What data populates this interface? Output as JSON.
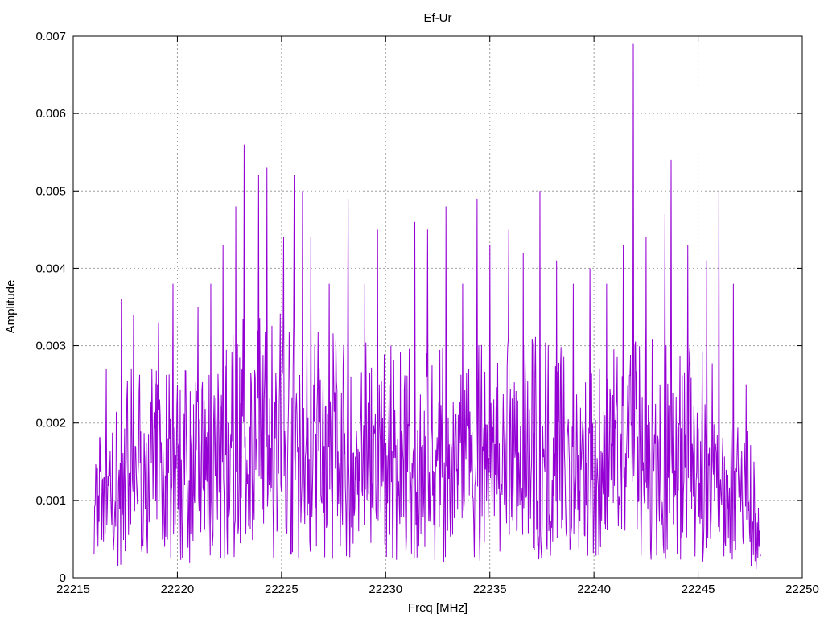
{
  "chart_data": {
    "type": "line",
    "title": "Ef-Ur",
    "xlabel": "Freq [MHz]",
    "ylabel": "Amplitude",
    "xlim": [
      22215,
      22250
    ],
    "ylim": [
      0,
      0.007
    ],
    "xticks": [
      22215,
      22220,
      22225,
      22230,
      22235,
      22240,
      22245,
      22250
    ],
    "yticks": [
      0,
      0.001,
      0.002,
      0.003,
      0.004,
      0.005,
      0.006,
      0.007
    ],
    "ytick_labels": [
      "0",
      "0.001",
      "0.002",
      "0.003",
      "0.004",
      "0.005",
      "0.006",
      "0.007"
    ],
    "grid": true,
    "legend": "none",
    "series": [
      {
        "color": "#9400d3",
        "x_start": 22216.0,
        "x_end": 22248.0,
        "points": 1200,
        "seed": 7,
        "envelope": [
          [
            22216.0,
            0.0012
          ],
          [
            22218.0,
            0.0019
          ],
          [
            22220.0,
            0.0018
          ],
          [
            22222.0,
            0.002
          ],
          [
            22224.0,
            0.0024
          ],
          [
            22226.0,
            0.0024
          ],
          [
            22228.0,
            0.0021
          ],
          [
            22230.0,
            0.002
          ],
          [
            22232.0,
            0.002
          ],
          [
            22234.0,
            0.002
          ],
          [
            22236.0,
            0.0021
          ],
          [
            22238.0,
            0.0021
          ],
          [
            22240.0,
            0.002
          ],
          [
            22242.0,
            0.0022
          ],
          [
            22244.0,
            0.0021
          ],
          [
            22246.0,
            0.0019
          ],
          [
            22247.0,
            0.0016
          ],
          [
            22248.0,
            0.0008
          ]
        ],
        "peaks": [
          [
            22216.6,
            0.0027
          ],
          [
            22217.3,
            0.0036
          ],
          [
            22217.9,
            0.0034
          ],
          [
            22219.1,
            0.0033
          ],
          [
            22219.8,
            0.0038
          ],
          [
            22221.0,
            0.0035
          ],
          [
            22221.6,
            0.0038
          ],
          [
            22222.2,
            0.0043
          ],
          [
            22222.8,
            0.0048
          ],
          [
            22223.2,
            0.0056
          ],
          [
            22223.9,
            0.0052
          ],
          [
            22224.3,
            0.0053
          ],
          [
            22225.1,
            0.0044
          ],
          [
            22225.6,
            0.0052
          ],
          [
            22226.0,
            0.005
          ],
          [
            22226.4,
            0.0044
          ],
          [
            22227.3,
            0.0038
          ],
          [
            22228.2,
            0.0049
          ],
          [
            22229.0,
            0.0038
          ],
          [
            22229.6,
            0.0045
          ],
          [
            22231.4,
            0.0046
          ],
          [
            22232.0,
            0.0045
          ],
          [
            22232.9,
            0.0048
          ],
          [
            22233.7,
            0.0038
          ],
          [
            22234.4,
            0.0049
          ],
          [
            22235.0,
            0.0043
          ],
          [
            22235.9,
            0.0045
          ],
          [
            22236.6,
            0.0042
          ],
          [
            22237.4,
            0.005
          ],
          [
            22238.2,
            0.0041
          ],
          [
            22239.0,
            0.0038
          ],
          [
            22239.8,
            0.004
          ],
          [
            22240.6,
            0.0038
          ],
          [
            22241.4,
            0.0043
          ],
          [
            22241.9,
            0.0069
          ],
          [
            22242.5,
            0.0044
          ],
          [
            22243.4,
            0.0047
          ],
          [
            22243.7,
            0.0054
          ],
          [
            22244.5,
            0.0043
          ],
          [
            22245.4,
            0.0041
          ],
          [
            22246.0,
            0.005
          ],
          [
            22246.7,
            0.0038
          ],
          [
            22247.3,
            0.0025
          ]
        ]
      }
    ]
  }
}
